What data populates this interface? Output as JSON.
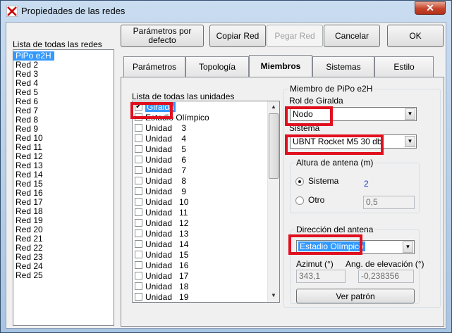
{
  "window": {
    "title": "Propiedades de las redes",
    "close_symbol": "✕"
  },
  "toolbar": {
    "defaults_label": "Parámetros por defecto",
    "copy_label": "Copiar Red",
    "paste_label": "Pegar Red",
    "cancel_label": "Cancelar",
    "ok_label": "OK"
  },
  "networks": {
    "header": "Lista de todas las redes",
    "items": [
      "PiPo e2H",
      "Red  2",
      "Red  3",
      "Red  4",
      "Red  5",
      "Red  6",
      "Red  7",
      "Red  8",
      "Red  9",
      "Red 10",
      "Red 11",
      "Red 12",
      "Red 13",
      "Red 14",
      "Red 15",
      "Red 16",
      "Red 17",
      "Red 18",
      "Red 19",
      "Red 20",
      "Red 21",
      "Red 22",
      "Red 23",
      "Red 24",
      "Red 25"
    ],
    "selected_index": 0
  },
  "tabs": [
    "Parámetros",
    "Topología",
    "Miembros",
    "Sistemas",
    "Estilo"
  ],
  "active_tab": "Miembros",
  "units": {
    "header": "Lista de todas las unidades",
    "items": [
      {
        "label": "Giralda",
        "checked": true,
        "selected": true
      },
      {
        "label": "Estadio Olímpico",
        "checked": false
      },
      {
        "label": "Unidad    3",
        "checked": false
      },
      {
        "label": "Unidad    4",
        "checked": false
      },
      {
        "label": "Unidad    5",
        "checked": false
      },
      {
        "label": "Unidad    6",
        "checked": false
      },
      {
        "label": "Unidad    7",
        "checked": false
      },
      {
        "label": "Unidad    8",
        "checked": false
      },
      {
        "label": "Unidad    9",
        "checked": false
      },
      {
        "label": "Unidad   10",
        "checked": false
      },
      {
        "label": "Unidad   11",
        "checked": false
      },
      {
        "label": "Unidad   12",
        "checked": false
      },
      {
        "label": "Unidad   13",
        "checked": false
      },
      {
        "label": "Unidad   14",
        "checked": false
      },
      {
        "label": "Unidad   15",
        "checked": false
      },
      {
        "label": "Unidad   16",
        "checked": false
      },
      {
        "label": "Unidad   17",
        "checked": false
      },
      {
        "label": "Unidad   18",
        "checked": false
      },
      {
        "label": "Unidad   19",
        "checked": false
      }
    ]
  },
  "member": {
    "group_title": "Miembro de PiPo e2H",
    "role_label": "Rol de Giralda",
    "role_value": "Nodo",
    "system_label": "Sistema",
    "system_value": "UBNT Rocket M5 30 dbi",
    "antenna_height": {
      "title": "Altura de antena (m)",
      "option_system": "Sistema",
      "system_value": "2",
      "option_other": "Otro",
      "other_value": "0,5",
      "selected": "Sistema"
    },
    "direction": {
      "title": "Dirección del antena",
      "value": "Estadio Olímpico",
      "azimuth_label": "Azimut (°)",
      "azimuth_value": "343,1",
      "elevation_label": "Ang. de elevación (°)",
      "elevation_value": "-0,238356",
      "pattern_button": "Ver patrón"
    }
  },
  "colors": {
    "highlight": "#3399ff",
    "annotation": "#e0101f"
  }
}
